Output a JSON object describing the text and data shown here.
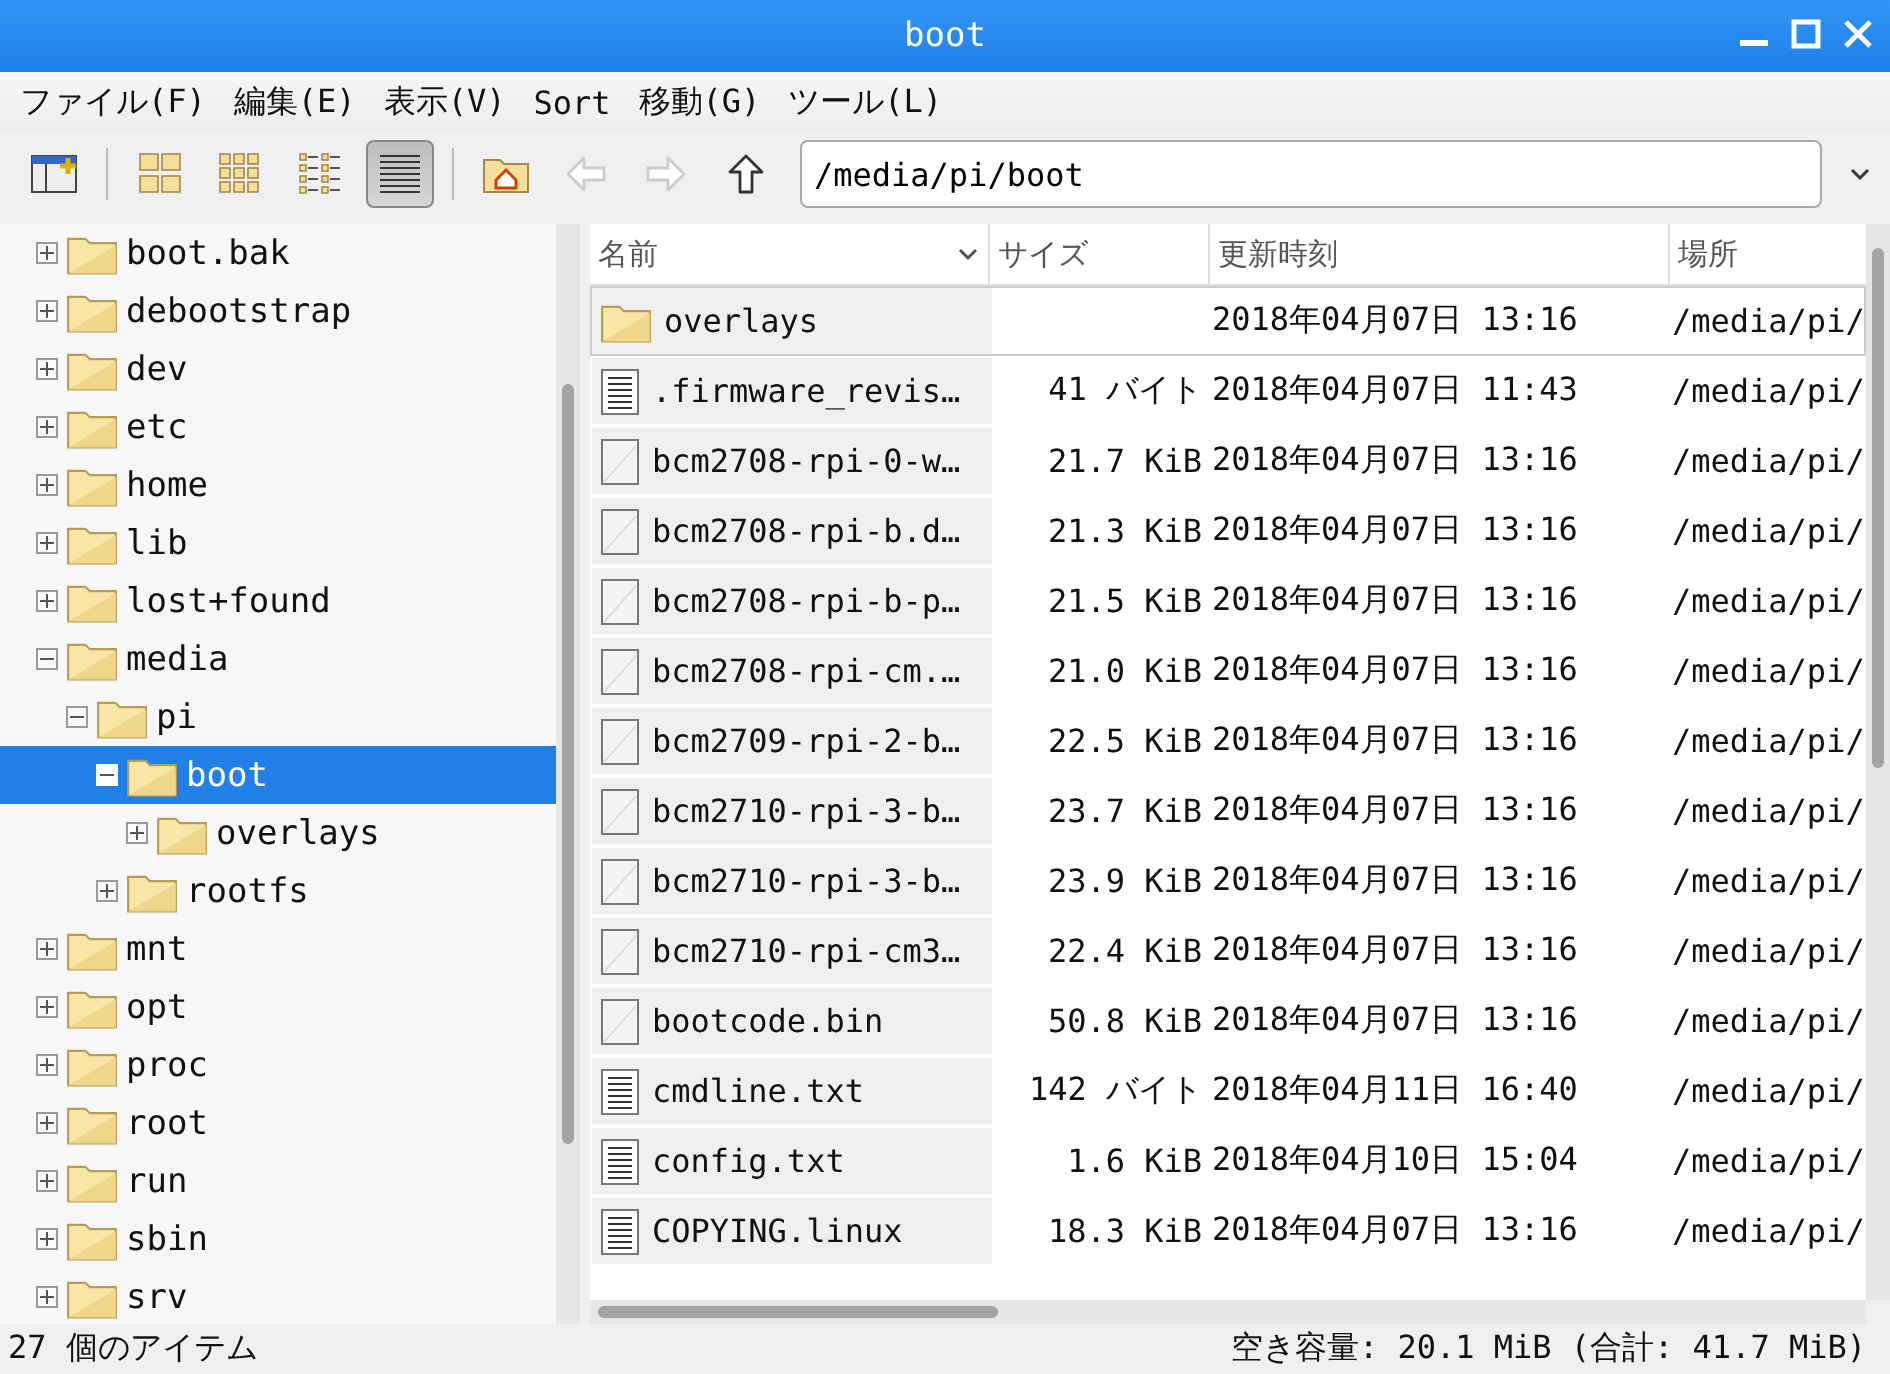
{
  "window": {
    "title": "boot"
  },
  "menu": [
    "ファイル(F)",
    "編集(E)",
    "表示(V)",
    "Sort",
    "移動(G)",
    "ツール(L)"
  ],
  "view_modes": [
    {
      "kind": "icons",
      "selected": false
    },
    {
      "kind": "thumbs",
      "selected": false
    },
    {
      "kind": "compact",
      "selected": false
    },
    {
      "kind": "list",
      "selected": true
    }
  ],
  "navigation": [
    {
      "kind": "back",
      "disabled": true
    },
    {
      "kind": "forward",
      "disabled": true
    },
    {
      "kind": "up",
      "disabled": false
    }
  ],
  "path": {
    "value": "/media/pi/boot"
  },
  "tree": [
    {
      "label": "boot.bak",
      "expanded": false,
      "selected": false
    },
    {
      "label": "debootstrap",
      "expanded": false,
      "selected": false
    },
    {
      "label": "dev",
      "expanded": false,
      "selected": false
    },
    {
      "label": "etc",
      "expanded": false,
      "selected": false
    },
    {
      "label": "home",
      "expanded": false,
      "selected": false
    },
    {
      "label": "lib",
      "expanded": false,
      "selected": false
    },
    {
      "label": "lost+found",
      "expanded": false,
      "selected": false
    },
    {
      "label": "media",
      "expanded": true,
      "selected": false,
      "children": [
        {
          "label": "pi",
          "expanded": true,
          "selected": false,
          "children": [
            {
              "label": "boot",
              "expanded": true,
              "selected": true,
              "children": [
                {
                  "label": "overlays",
                  "expanded": false,
                  "selected": false
                }
              ]
            },
            {
              "label": "rootfs",
              "expanded": false,
              "selected": false
            }
          ]
        }
      ]
    },
    {
      "label": "mnt",
      "expanded": false,
      "selected": false
    },
    {
      "label": "opt",
      "expanded": false,
      "selected": false
    },
    {
      "label": "proc",
      "expanded": false,
      "selected": false
    },
    {
      "label": "root",
      "expanded": false,
      "selected": false
    },
    {
      "label": "run",
      "expanded": false,
      "selected": false
    },
    {
      "label": "sbin",
      "expanded": false,
      "selected": false
    },
    {
      "label": "srv",
      "expanded": false,
      "selected": false
    }
  ],
  "table": {
    "columns": [
      "名前",
      "サイズ",
      "更新時刻",
      "場所"
    ],
    "rows": [
      {
        "kind": "folder",
        "name": "overlays",
        "size": "",
        "modified": "2018年04月07日 13:16",
        "location": "/media/pi/",
        "selected": true
      },
      {
        "kind": "text",
        "name": ".firmware_revis…",
        "size": "41 バイト",
        "modified": "2018年04月07日 11:43",
        "location": "/media/pi/",
        "selected": false
      },
      {
        "kind": "file",
        "name": "bcm2708-rpi-0-w…",
        "size": "21.7 KiB",
        "modified": "2018年04月07日 13:16",
        "location": "/media/pi/",
        "selected": false
      },
      {
        "kind": "file",
        "name": "bcm2708-rpi-b.d…",
        "size": "21.3 KiB",
        "modified": "2018年04月07日 13:16",
        "location": "/media/pi/",
        "selected": false
      },
      {
        "kind": "file",
        "name": "bcm2708-rpi-b-p…",
        "size": "21.5 KiB",
        "modified": "2018年04月07日 13:16",
        "location": "/media/pi/",
        "selected": false
      },
      {
        "kind": "file",
        "name": "bcm2708-rpi-cm.…",
        "size": "21.0 KiB",
        "modified": "2018年04月07日 13:16",
        "location": "/media/pi/",
        "selected": false
      },
      {
        "kind": "file",
        "name": "bcm2709-rpi-2-b…",
        "size": "22.5 KiB",
        "modified": "2018年04月07日 13:16",
        "location": "/media/pi/",
        "selected": false
      },
      {
        "kind": "file",
        "name": "bcm2710-rpi-3-b…",
        "size": "23.7 KiB",
        "modified": "2018年04月07日 13:16",
        "location": "/media/pi/",
        "selected": false
      },
      {
        "kind": "file",
        "name": "bcm2710-rpi-3-b…",
        "size": "23.9 KiB",
        "modified": "2018年04月07日 13:16",
        "location": "/media/pi/",
        "selected": false
      },
      {
        "kind": "file",
        "name": "bcm2710-rpi-cm3…",
        "size": "22.4 KiB",
        "modified": "2018年04月07日 13:16",
        "location": "/media/pi/",
        "selected": false
      },
      {
        "kind": "file",
        "name": "bootcode.bin",
        "size": "50.8 KiB",
        "modified": "2018年04月07日 13:16",
        "location": "/media/pi/",
        "selected": false
      },
      {
        "kind": "text",
        "name": "cmdline.txt",
        "size": "142 バイト",
        "modified": "2018年04月11日 16:40",
        "location": "/media/pi/",
        "selected": false
      },
      {
        "kind": "text",
        "name": "config.txt",
        "size": "1.6 KiB",
        "modified": "2018年04月10日 15:04",
        "location": "/media/pi/",
        "selected": false
      },
      {
        "kind": "text",
        "name": "COPYING.linux",
        "size": "18.3 KiB",
        "modified": "2018年04月07日 13:16",
        "location": "/media/pi/",
        "selected": false
      }
    ]
  },
  "status_bar": {
    "items": "27 個のアイテム",
    "free_space": "空き容量: 20.1 MiB (合計: 41.7 MiB)"
  }
}
